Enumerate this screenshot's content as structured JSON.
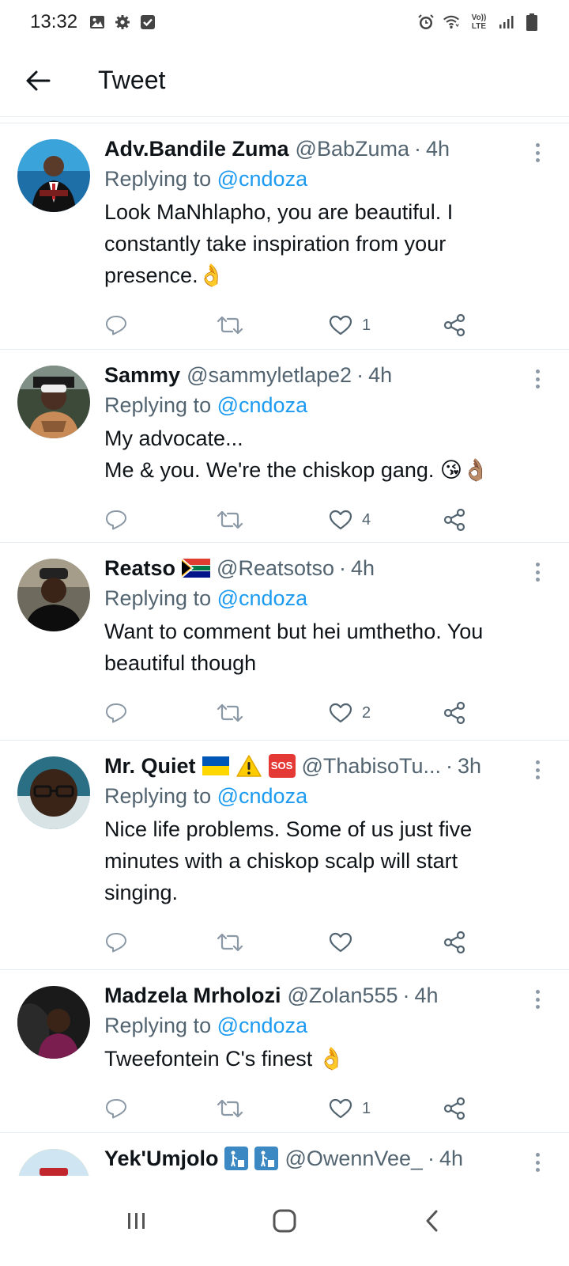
{
  "status_bar": {
    "time": "13:32",
    "left_icons": [
      "gallery-icon",
      "settings-icon",
      "checkbox-icon"
    ],
    "right_icons": [
      "alarm-icon",
      "wifi-icon",
      "volte-icon",
      "signal-icon",
      "battery-icon"
    ],
    "volte_text_top": "Vo))",
    "volte_text_bottom": "LTE"
  },
  "header": {
    "title": "Tweet"
  },
  "reply_prefix": "Replying to",
  "tweets": [
    {
      "display_name": "Adv.Bandile Zuma",
      "handle": "@BabZuma",
      "time": "4h",
      "mention": "@cndoza",
      "text_lines": [
        "Look MaNhlapho, you are beautiful. I",
        "constantly take inspiration from your",
        "presence.👌"
      ],
      "likes": "1"
    },
    {
      "display_name": "Sammy",
      "handle": "@sammyletlape2",
      "time": "4h",
      "mention": "@cndoza",
      "text_lines": [
        "My advocate...",
        "Me & you. We're the chiskop gang. 😘👌🏽"
      ],
      "likes": "4"
    },
    {
      "display_name": "Reatso",
      "name_emoji": "south-africa-flag-icon",
      "handle": "@Reatsotso",
      "time": "4h",
      "mention": "@cndoza",
      "text_lines": [
        "Want to comment but hei umthetho. You",
        "beautiful though"
      ],
      "likes": "2"
    },
    {
      "display_name": "Mr. Quiet",
      "name_emoji": [
        "ukraine-flag-icon",
        "warning-icon",
        "sos-icon"
      ],
      "sos_text": "SOS",
      "handle": "@ThabisoTu...",
      "time": "3h",
      "mention": "@cndoza",
      "text_lines": [
        "Nice life problems. Some of us just five",
        "minutes with a chiskop scalp will start",
        "singing."
      ],
      "likes": ""
    },
    {
      "display_name": "Madzela Mrholozi",
      "handle": "@Zolan555",
      "time": "4h",
      "mention": "@cndoza",
      "text_lines": [
        "Tweefontein C's finest 👌"
      ],
      "likes": "1"
    },
    {
      "display_name": "Yek'Umjolo",
      "name_emoji": [
        "trash-person-icon",
        "trash-person-icon"
      ],
      "handle": "@OwennVee_",
      "time": "4h"
    }
  ],
  "nav_bar": {
    "icons": [
      "recents-icon",
      "home-icon",
      "back-icon"
    ]
  },
  "colors": {
    "accent": "#1d9bf0",
    "muted": "#536471",
    "divider": "#e6ecf0"
  }
}
